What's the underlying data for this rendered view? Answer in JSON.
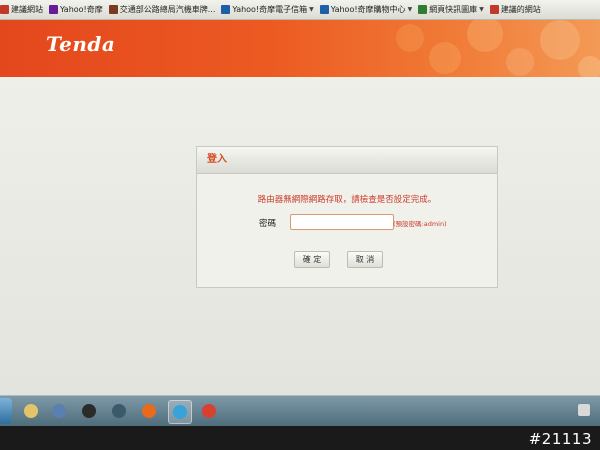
{
  "favorites": [
    {
      "label": "建議網站",
      "color": "#c0392b",
      "has_dropdown": false
    },
    {
      "label": "Yahoo!奇摩",
      "color": "#6a1b9a",
      "has_dropdown": false
    },
    {
      "label": "交通部公路總局汽機車牌...",
      "color": "#7a3b1e",
      "has_dropdown": false
    },
    {
      "label": "Yahoo!奇摩電子信箱",
      "color": "#1f5fa8",
      "has_dropdown": true
    },
    {
      "label": "Yahoo!奇摩購物中心",
      "color": "#1f5fa8",
      "has_dropdown": true
    },
    {
      "label": "網頁快訊圖庫",
      "color": "#2e7d32",
      "has_dropdown": true
    },
    {
      "label": "建議的網站",
      "color": "#c0392b",
      "has_dropdown": false
    }
  ],
  "header": {
    "logo": "Tenda",
    "brand_color": "#e4471d"
  },
  "login": {
    "title": "登入",
    "warning": "路由器無網際網路存取，請檢查是否設定完成。",
    "password_label": "密碼",
    "password_value": "",
    "password_hint": "(預設密碼:admin)",
    "ok_label": "確 定",
    "cancel_label": "取 消"
  },
  "taskbar": {
    "icons": [
      {
        "name": "file-explorer-icon",
        "color": "#e3c46a",
        "active": false
      },
      {
        "name": "mail-icon",
        "color": "#5b7fb0",
        "active": false
      },
      {
        "name": "media-player-icon",
        "color": "#2b2b2b",
        "active": false
      },
      {
        "name": "network-icon",
        "color": "#3a5a6a",
        "active": false
      },
      {
        "name": "firefox-icon",
        "color": "#e86a1c",
        "active": false
      },
      {
        "name": "internet-explorer-icon",
        "color": "#39a2d8",
        "active": true
      },
      {
        "name": "chrome-icon",
        "color": "#d8412f",
        "active": false
      }
    ]
  },
  "watermark": "#21113"
}
